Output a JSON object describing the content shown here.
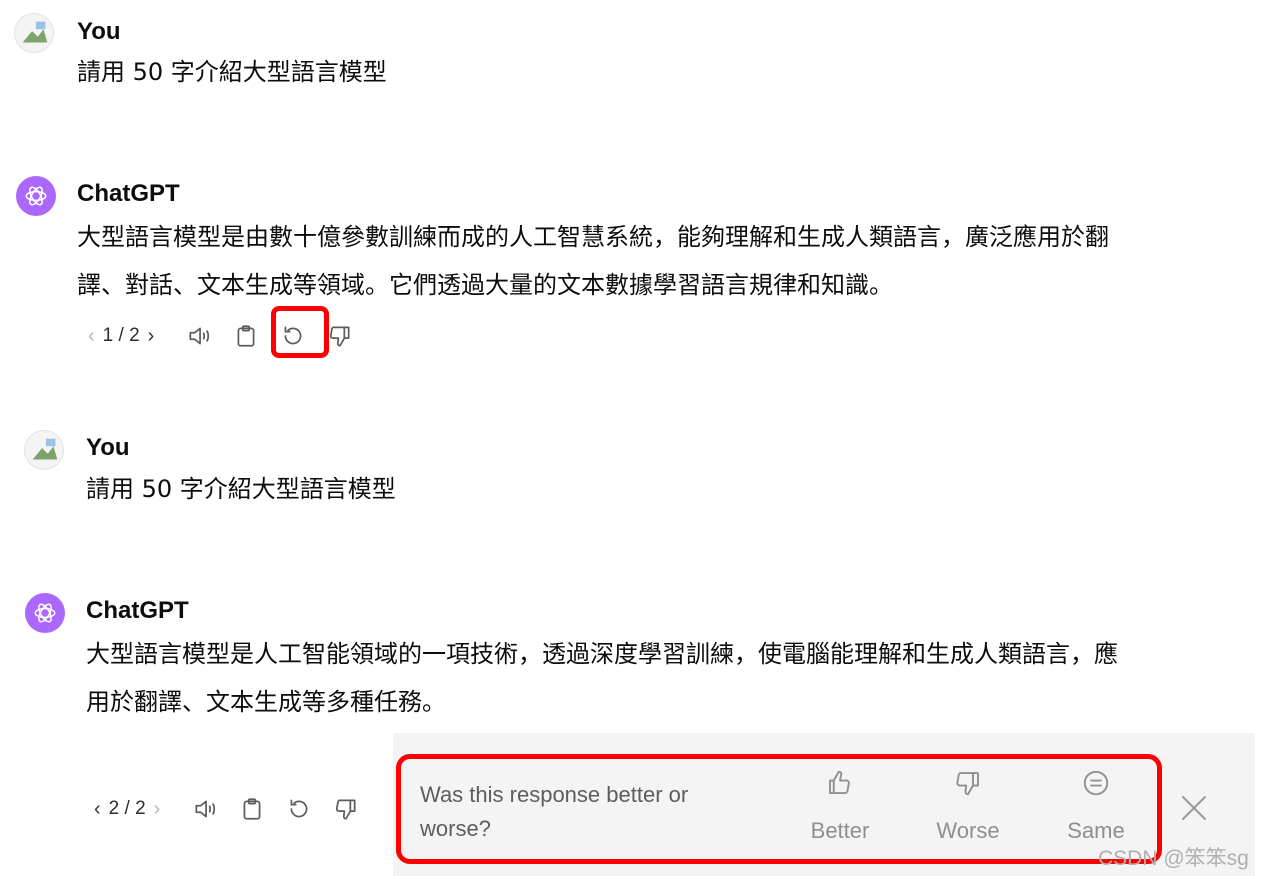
{
  "conversation": [
    {
      "author": "You",
      "text": "請用 50 字介紹大型語言模型"
    },
    {
      "author": "ChatGPT",
      "lines": [
        "大型語言模型是由數十億參數訓練而成的人工智慧系統，能夠理解和生成人類語言，廣泛應用於翻",
        "譯、對話、文本生成等領域。它們透過大量的文本數據學習語言規律和知識。"
      ],
      "pager": "1 / 2"
    },
    {
      "author": "You",
      "text": "請用 50 字介紹大型語言模型"
    },
    {
      "author": "ChatGPT",
      "lines": [
        "大型語言模型是人工智能領域的一項技術，透過深度學習訓練，使電腦能理解和生成人類語言，應",
        "用於翻譯、文本生成等多種任務。"
      ],
      "pager": "2 / 2"
    }
  ],
  "pager_prev": "‹",
  "pager_next": "›",
  "feedback": {
    "question": "Was this response better or worse?",
    "options": [
      "Better",
      "Worse",
      "Same"
    ]
  },
  "icons": [
    "speaker-icon",
    "copy-icon",
    "regenerate-icon",
    "thumbs-down-icon",
    "thumbs-up-icon",
    "equal-icon",
    "close-icon",
    "openai-logo-icon"
  ],
  "colors": {
    "highlight": "#ff0000",
    "gpt_avatar": "#ab68ff",
    "feedback_bg": "#f4f4f4"
  },
  "watermark": "CSDN @笨笨sg"
}
